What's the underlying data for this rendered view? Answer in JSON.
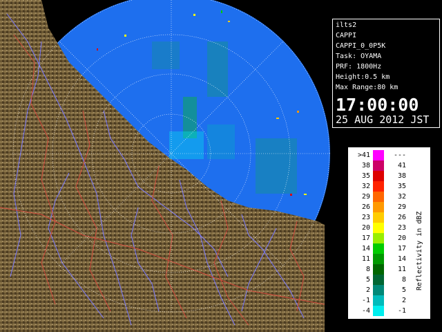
{
  "info": {
    "station": "ilts2",
    "product": "CAPPI",
    "product_code": "CAPPI_0_0P5K",
    "task": "Task: OYAMA",
    "prf": "PRF: 1800Hz",
    "height": "Height:0.5 km",
    "max_range": "Max Range:80 km",
    "time": "17:00:00",
    "date": "25 AUG 2012 JST"
  },
  "legend": {
    "title": "Reflectivity in dBZ",
    "rows": [
      {
        "lo": ">41",
        "hi": "---",
        "color": "#ff00ff"
      },
      {
        "lo": "38",
        "hi": "41",
        "color": "#cc0066"
      },
      {
        "lo": "35",
        "hi": "38",
        "color": "#dd0000"
      },
      {
        "lo": "32",
        "hi": "35",
        "color": "#ff2200"
      },
      {
        "lo": "29",
        "hi": "32",
        "color": "#ff6600"
      },
      {
        "lo": "26",
        "hi": "29",
        "color": "#ff9900"
      },
      {
        "lo": "23",
        "hi": "26",
        "color": "#ffcc00"
      },
      {
        "lo": "20",
        "hi": "23",
        "color": "#ffff00"
      },
      {
        "lo": "17",
        "hi": "20",
        "color": "#99ee00"
      },
      {
        "lo": "14",
        "hi": "17",
        "color": "#00cc00"
      },
      {
        "lo": "11",
        "hi": "14",
        "color": "#009900"
      },
      {
        "lo": "8",
        "hi": "11",
        "color": "#006600"
      },
      {
        "lo": "5",
        "hi": "8",
        "color": "#006633"
      },
      {
        "lo": "2",
        "hi": "5",
        "color": "#008877"
      },
      {
        "lo": "-1",
        "hi": "2",
        "color": "#00bbbb"
      },
      {
        "lo": "-4",
        "hi": "-1",
        "color": "#00eeee"
      }
    ]
  },
  "colors": {
    "sea": "#1e6fee",
    "land": "#6e5a36",
    "rivers": "#7a7aff",
    "boundaries": "#d24a3c",
    "range_rings": "#ffffff"
  }
}
